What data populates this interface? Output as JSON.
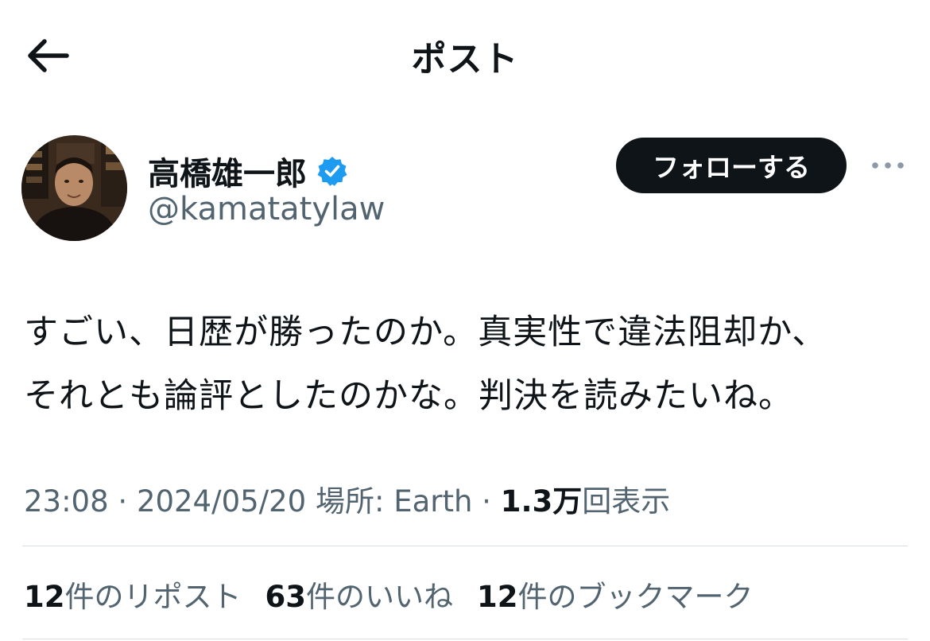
{
  "header": {
    "title": "ポスト",
    "back_icon": "arrow-left-icon"
  },
  "author": {
    "name": "高橋雄一郎",
    "handle": "@kamatatylaw",
    "verified_icon": "verified-badge-icon",
    "verified_color": "#1d9bf0"
  },
  "follow_button": {
    "label": "フォローする"
  },
  "more_icon": "more-horizontal-icon",
  "post": {
    "text_line1": "すごい、日歴が勝ったのか。真実性で違法阻却か、",
    "text_line2": "それとも論評としたのかな。判決を読みたいね。"
  },
  "meta": {
    "time": "23:08",
    "separator": " · ",
    "date": "2024/05/20",
    "location": "場所: Earth",
    "views_count": "1.3万",
    "views_label": "回表示"
  },
  "stats": {
    "reposts_count": "12",
    "reposts_label": "件のリポスト",
    "likes_count": "63",
    "likes_label": "件のいいね",
    "bookmarks_count": "12",
    "bookmarks_label": "件のブックマーク"
  },
  "colors": {
    "text": "#0f1419",
    "secondary": "#536471",
    "button_bg": "#0f1419",
    "divider": "#d9dee2"
  }
}
